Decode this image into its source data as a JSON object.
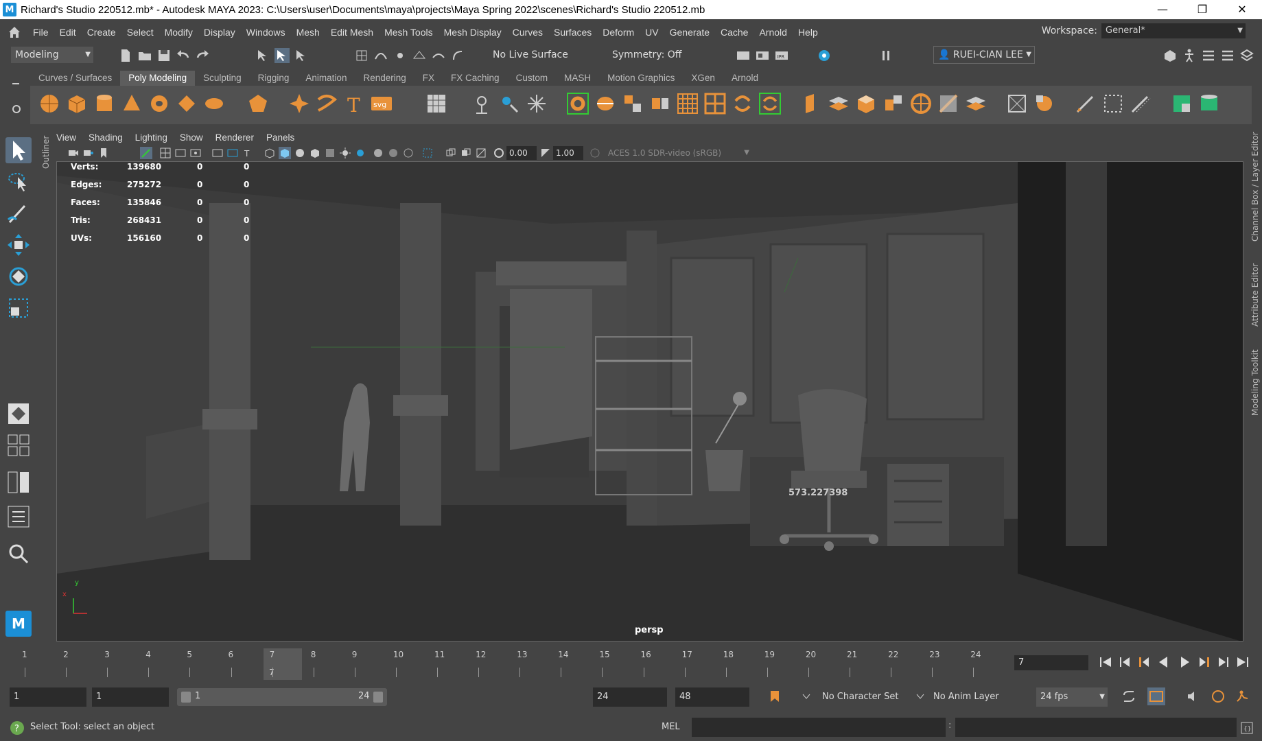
{
  "window": {
    "title": "Richard's Studio 220512.mb* - Autodesk MAYA 2023: C:\\Users\\user\\Documents\\maya\\projects\\Maya Spring 2022\\scenes\\Richard's Studio 220512.mb",
    "logo": "M",
    "minimize": "—",
    "restore": "❐",
    "close": "✕"
  },
  "menus": [
    "File",
    "Edit",
    "Create",
    "Select",
    "Modify",
    "Display",
    "Windows",
    "Mesh",
    "Edit Mesh",
    "Mesh Tools",
    "Mesh Display",
    "Curves",
    "Surfaces",
    "Deform",
    "UV",
    "Generate",
    "Cache",
    "Arnold",
    "Help"
  ],
  "workspace": {
    "label": "Workspace:",
    "value": "General*"
  },
  "statusline": {
    "menu_set": "Modeling",
    "live_surface": "No Live Surface",
    "symmetry": "Symmetry: Off",
    "user": "RUEI-CIAN LEE"
  },
  "shelf_tabs": [
    "Curves / Surfaces",
    "Poly Modeling",
    "Sculpting",
    "Rigging",
    "Animation",
    "Rendering",
    "FX",
    "FX Caching",
    "Custom",
    "MASH",
    "Motion Graphics",
    "XGen",
    "Arnold"
  ],
  "shelf_active": "Poly Modeling",
  "panel_menus": [
    "View",
    "Shading",
    "Lighting",
    "Show",
    "Renderer",
    "Panels"
  ],
  "panel_toolbar": {
    "exposure": "0.00",
    "gamma": "1.00",
    "color_space": "ACES 1.0 SDR-video (sRGB)"
  },
  "outliner_tab": "Outliner",
  "hud": [
    {
      "label": "Verts:",
      "v1": "139680",
      "v2": "0",
      "v3": "0"
    },
    {
      "label": "Edges:",
      "v1": "275272",
      "v2": "0",
      "v3": "0"
    },
    {
      "label": "Faces:",
      "v1": "135846",
      "v2": "0",
      "v3": "0"
    },
    {
      "label": "Tris:",
      "v1": "268431",
      "v2": "0",
      "v3": "0"
    },
    {
      "label": "UVs:",
      "v1": "156160",
      "v2": "0",
      "v3": "0"
    }
  ],
  "viewport": {
    "camera": "persp",
    "measure": "573.227398",
    "axis_y": "y",
    "axis_x": "x"
  },
  "right_tabs": [
    "Channel Box / Layer Editor",
    "Attribute Editor",
    "Modeling Toolkit"
  ],
  "timeline": {
    "frames": [
      "1",
      "2",
      "3",
      "4",
      "5",
      "6",
      "7",
      "8",
      "9",
      "10",
      "11",
      "12",
      "13",
      "14",
      "15",
      "16",
      "17",
      "18",
      "19",
      "20",
      "21",
      "22",
      "23",
      "24"
    ],
    "current": "7",
    "current_field": "7"
  },
  "range": {
    "start": "1",
    "playback_start": "1",
    "slider_start": "1",
    "slider_end": "24",
    "playback_end": "24",
    "end": "48",
    "character_set": "No Character Set",
    "anim_layer": "No Anim Layer",
    "fps": "24 fps"
  },
  "helpline": {
    "message": "Select Tool: select an object",
    "mel": "MEL",
    "colon": ":"
  },
  "colors": {
    "accent": "#e8923a",
    "tool_active": "#5b6f83",
    "mel_logo": "#1b8fd6"
  }
}
